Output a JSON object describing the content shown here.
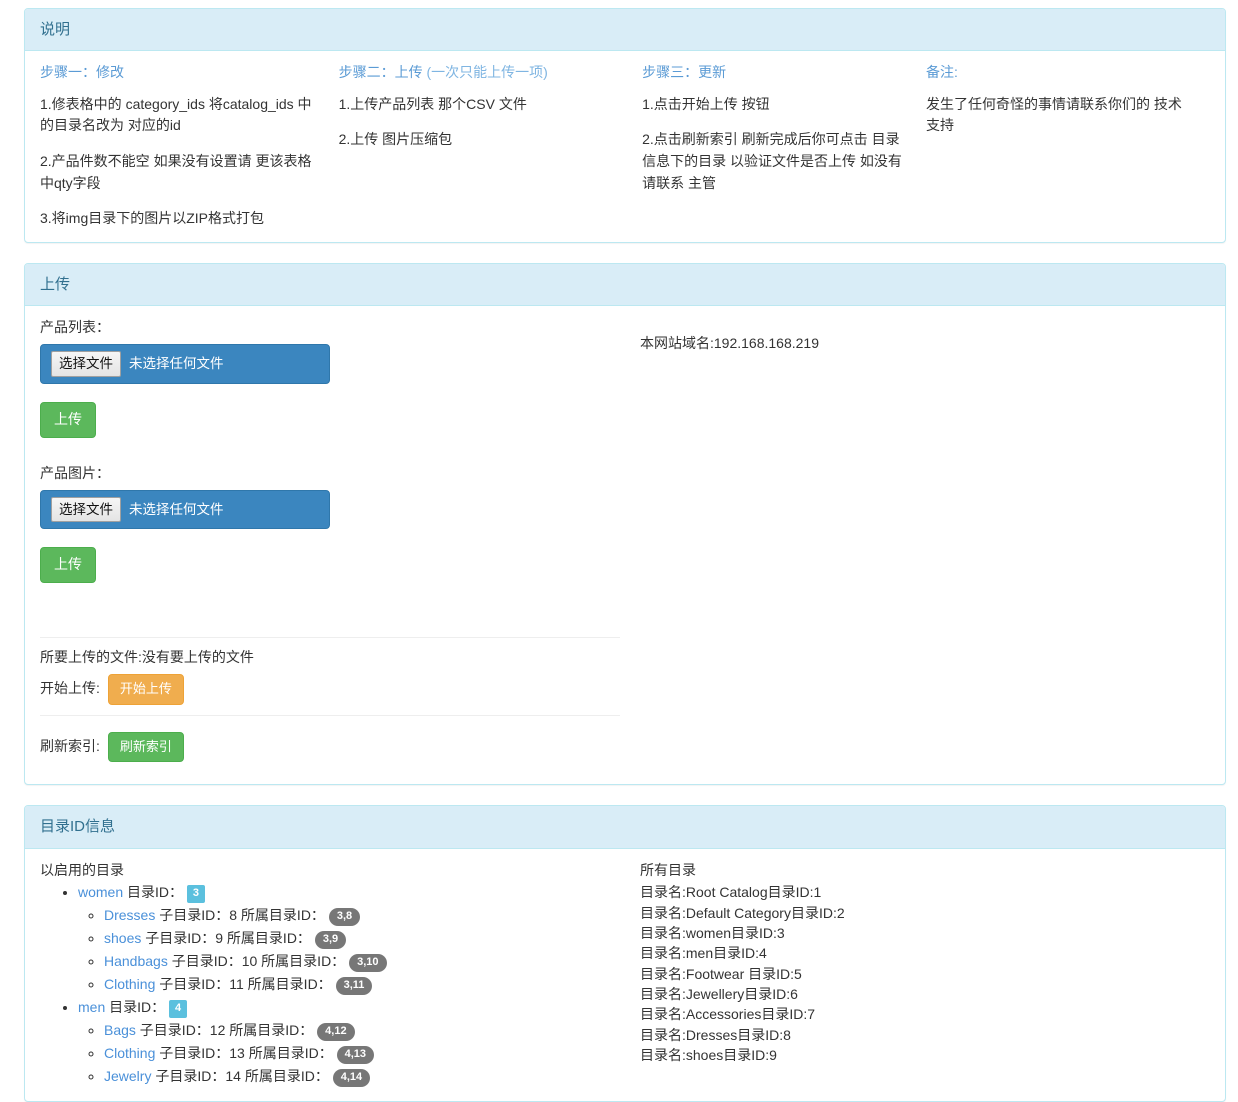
{
  "instructions_panel": {
    "title": "说明",
    "columns": [
      {
        "heading": "步骤一：修改",
        "heading_sub": "",
        "items": [
          "1.修表格中的 category_ids 将catalog_ids 中的目录名改为 对应的id",
          "2.产品件数不能空 如果没有设置请 更该表格中qty字段",
          "3.将img目录下的图片以ZIP格式打包"
        ]
      },
      {
        "heading": "步骤二：上传",
        "heading_sub": "(一次只能上传一项)",
        "items": [
          "1.上传产品列表 那个CSV 文件",
          "2.上传 图片压缩包"
        ]
      },
      {
        "heading": "步骤三：更新",
        "heading_sub": "",
        "items": [
          "1.点击开始上传 按钮",
          "2.点击刷新索引 刷新完成后你可点击 目录信息下的目录 以验证文件是否上传 如没有请联系 主管"
        ]
      },
      {
        "heading": "备注:",
        "heading_sub": "",
        "items": [
          "发生了任何奇怪的事情请联系你们的 技术支持"
        ]
      }
    ]
  },
  "upload_panel": {
    "title": "上传",
    "product_list_label": "产品列表：",
    "product_list_file_button": "选择文件",
    "product_list_file_status": "未选择任何文件",
    "product_list_upload_button": "上传",
    "product_image_label": "产品图片：",
    "product_image_file_button": "选择文件",
    "product_image_file_status": "未选择任何文件",
    "product_image_upload_button": "上传",
    "pending_files_text": "所要上传的文件:没有要上传的文件",
    "start_upload_label": "开始上传:",
    "start_upload_button": "开始上传",
    "reindex_label": "刷新索引:",
    "reindex_button": "刷新索引",
    "site_domain_text": "本网站域名:192.168.168.219"
  },
  "catalog_panel": {
    "title": "目录ID信息",
    "enabled_title": "以启用的目录",
    "all_title": "所有目录",
    "labels": {
      "catalog_id": "目录ID：",
      "sub_catalog_id": "子目录ID：",
      "parent_catalog_id": "所属目录ID：",
      "name_prefix": "目录名:",
      "id_prefix": "目录ID:"
    },
    "tree": [
      {
        "name": "women",
        "id": "3",
        "children": [
          {
            "name": "Dresses",
            "sub_id": "8",
            "parent_ids": "3,8"
          },
          {
            "name": "shoes",
            "sub_id": "9",
            "parent_ids": "3,9"
          },
          {
            "name": "Handbags",
            "sub_id": "10",
            "parent_ids": "3,10"
          },
          {
            "name": "Clothing",
            "sub_id": "11",
            "parent_ids": "3,11"
          }
        ]
      },
      {
        "name": "men",
        "id": "4",
        "children": [
          {
            "name": "Bags",
            "sub_id": "12",
            "parent_ids": "4,12"
          },
          {
            "name": "Clothing",
            "sub_id": "13",
            "parent_ids": "4,13"
          },
          {
            "name": "Jewelry",
            "sub_id": "14",
            "parent_ids": "4,14"
          }
        ]
      }
    ],
    "all_catalogs": [
      {
        "name": "Root Catalog",
        "id": "1"
      },
      {
        "name": "Default Category",
        "id": "2"
      },
      {
        "name": "women",
        "id": "3"
      },
      {
        "name": "men",
        "id": "4"
      },
      {
        "name": "Footwear ",
        "id": "5"
      },
      {
        "name": "Jewellery",
        "id": "6"
      },
      {
        "name": "Accessories",
        "id": "7"
      },
      {
        "name": "Dresses",
        "id": "8"
      },
      {
        "name": "shoes",
        "id": "9"
      }
    ]
  },
  "colors": {
    "panel_border": "#bce8f1",
    "panel_heading_bg": "#d9edf7",
    "panel_title": "#31708f",
    "link_blue": "#4a90d9",
    "step_heading": "#5b9bd5",
    "file_input_bg": "#3b86bf",
    "success": "#5cb85c",
    "warning": "#f0ad4e",
    "badge_info": "#5bc0de",
    "badge_default": "#777777"
  }
}
